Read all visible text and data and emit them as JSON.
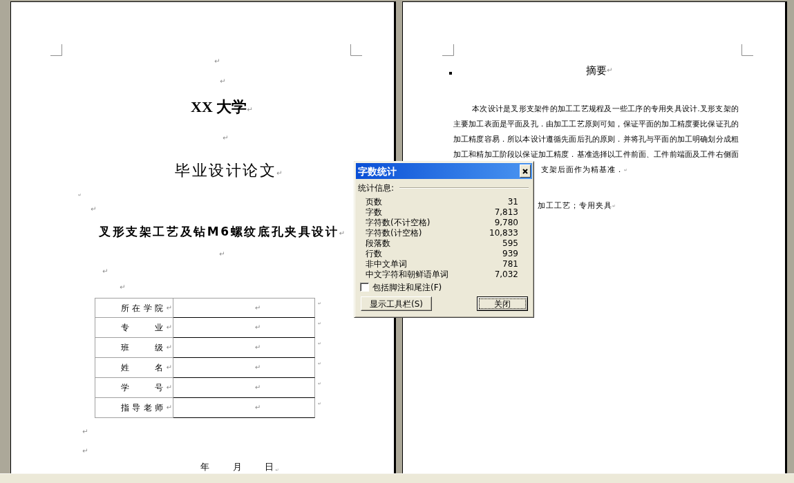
{
  "cover_page": {
    "paragraphs": [
      {
        "kind": "mark",
        "mark": "↵"
      },
      {
        "kind": "mark",
        "mark": "↵"
      },
      {
        "kind": "school",
        "text": "XX 大学",
        "mark": "↵"
      },
      {
        "kind": "mark",
        "mark": "↵"
      },
      {
        "kind": "title",
        "text": "毕业设计论文",
        "mark": "↵"
      },
      {
        "kind": "small_mark",
        "mark": "↵"
      },
      {
        "kind": "mark",
        "mark": "↵"
      },
      {
        "kind": "topic",
        "text": "叉形支架工艺及钻M6螺纹底孔夹具设计",
        "mark": "↵"
      },
      {
        "kind": "mark",
        "mark": "↵"
      },
      {
        "kind": "mark",
        "mark": "↵"
      },
      {
        "kind": "mark",
        "mark": "↵"
      }
    ],
    "info_table": {
      "rows": [
        {
          "label": "所在学院",
          "label_mark": "↵",
          "value_mark": "↵",
          "row_mark": "↵"
        },
        {
          "label": "专　　业",
          "label_mark": "↵",
          "value_mark": "↵",
          "row_mark": "↵"
        },
        {
          "label": "班　　级",
          "label_mark": "↵",
          "value_mark": "↵",
          "row_mark": "↵"
        },
        {
          "label": "姓　　名",
          "label_mark": "↵",
          "value_mark": "↵",
          "row_mark": "↵"
        },
        {
          "label": "学　　号",
          "label_mark": "↵",
          "value_mark": "↵",
          "row_mark": "↵"
        },
        {
          "label": "指导老师",
          "label_mark": "↵",
          "value_mark": "↵",
          "row_mark": "↵"
        }
      ]
    },
    "after_table": [
      {
        "kind": "mark",
        "mark": "↵"
      },
      {
        "kind": "mark",
        "mark": "↵"
      }
    ],
    "date_line": {
      "text": "年　　月　　日",
      "mark": "↵"
    }
  },
  "abstract_page": {
    "heading": {
      "text": "摘要",
      "mark": "↵"
    },
    "body_lines": [
      "本次设计是叉形支架件的加工工艺规程及一些工序的专用夹具设计.叉形支架的",
      "主要加工表面是平面及孔．由加工工艺原则可知，保证平面的加工精度要比保证孔的",
      "加工精度容易．所以本设计遵循先面后孔的原则．并将孔与平面的加工明确划分成粗",
      "加工和精加工阶段以保证加工精度．基准选择以工件前面、工件前端面及工件右侧面",
      "支架后面作为精基准．"
    ],
    "body_mark": "↵",
    "second_paragraph": {
      "text": "加工工艺；专用夹具",
      "mark": "↵"
    }
  },
  "word_count_dialog": {
    "title": "字数统计",
    "section_label": "统计信息:",
    "stats": [
      {
        "label": "页数",
        "value": "31"
      },
      {
        "label": "字数",
        "value": "7,813"
      },
      {
        "label": "字符数(不计空格)",
        "value": "9,780"
      },
      {
        "label": "字符数(计空格)",
        "value": "10,833"
      },
      {
        "label": "段落数",
        "value": "595"
      },
      {
        "label": "行数",
        "value": "939"
      },
      {
        "label": "非中文单词",
        "value": "781"
      },
      {
        "label": "中文字符和朝鲜语单词",
        "value": "7,032"
      }
    ],
    "include_notes": {
      "label": "包括脚注和尾注(F)",
      "checked": false
    },
    "buttons": [
      {
        "label": "显示工具栏(S)",
        "focused": false
      },
      {
        "label": "关闭",
        "focused": true
      }
    ]
  }
}
